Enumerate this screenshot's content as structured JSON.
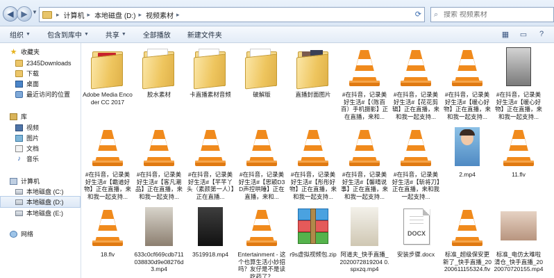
{
  "window": {
    "breadcrumb": [
      "计算机",
      "本地磁盘 (D:)",
      "视频素材"
    ],
    "search_placeholder": "搜索 视频素材"
  },
  "toolbar": {
    "organize": "组织",
    "include_in_library": "包含到库中",
    "share": "共享",
    "slideshow": "全部播放",
    "new_folder": "新建文件夹"
  },
  "nav": {
    "favorites_header": "收藏夹",
    "favorites": [
      "2345Downloads",
      "下载",
      "桌面",
      "最近访问的位置"
    ],
    "libraries_header": "库",
    "libraries": [
      "视频",
      "图片",
      "文档",
      "音乐"
    ],
    "computer_header": "计算机",
    "drives": [
      "本地磁盘 (C:)",
      "本地磁盘 (D:)",
      "本地磁盘 (E:)"
    ],
    "network_header": "网络"
  },
  "files": [
    {
      "name": "Adobe Media Encoder CC 2017",
      "icon": "folder-adobe-icon"
    },
    {
      "name": "胶水素材",
      "icon": "folder-icon"
    },
    {
      "name": "卡直播素材音频",
      "icon": "folder-icon"
    },
    {
      "name": "破解版",
      "icon": "folder-icon"
    },
    {
      "name": "直播封面图片",
      "icon": "folder-photos-icon"
    },
    {
      "name": "#在抖音，记录美好生活#【（陈百百）手机摄影】正在直播，来和...",
      "icon": "vlc-icon"
    },
    {
      "name": "#在抖音，记录美好生活#【花花剪辑】正在直播，来和我一起支持...",
      "icon": "vlc-icon"
    },
    {
      "name": "#在抖音，记录美好生活#【暖心好物】正在直播，来和我一起支持...",
      "icon": "vlc-icon"
    },
    {
      "name": "#在抖音，记录美好生活#【暖心好物】正在直播，来和我一起支持...",
      "icon": "video-thumb-phone"
    },
    {
      "name": "#在抖音，记录美好生活#【霸道好物】正在直播，来和我一起支持...",
      "icon": "vlc-icon"
    },
    {
      "name": "#在抖音，记录美好生活#【客凡潮品】正在直播，来和我一起支持...",
      "icon": "vlc-icon"
    },
    {
      "name": "#在抖音，记录美好生活#【芊芊丫头（素颜第一人）】正在直播...",
      "icon": "vlc-icon"
    },
    {
      "name": "#在抖音，记录美好生活#【思颖D3D声控哄睡】正在直播，来和...",
      "icon": "vlc-icon"
    },
    {
      "name": "#在抖音，记录美好生活#【彤彤好物】正在直播，来和我一起支持...",
      "icon": "vlc-icon"
    },
    {
      "name": "#在抖音，记录美好生活#【馨晴说事】正在直播，来和我一起支持...",
      "icon": "vlc-icon"
    },
    {
      "name": "#在抖音，记录美好生活#【斩将刀】正在直播，来和我一起支持...",
      "icon": "vlc-icon"
    },
    {
      "name": "2.mp4",
      "icon": "video-thumb-kid"
    },
    {
      "name": "11.flv",
      "icon": "vlc-icon"
    },
    {
      "name": "18.flv",
      "icon": "vlc-icon"
    },
    {
      "name": "633c0cf669cdb711038830d9e08276d3.mp4",
      "icon": "video-thumb-room"
    },
    {
      "name": "3519918.mp4",
      "icon": "video-thumb-dark"
    },
    {
      "name": "Entertainment - 这个也算生活小妙招吗？友仔是不是读吃药了？",
      "icon": "vlc-icon"
    },
    {
      "name": "r9s虚拟视频包.zip",
      "icon": "zip-archive-icon"
    },
    {
      "name": "阿道夫_快手直播_2020072819204 0.spxzq.mp4",
      "icon": "video-thumb-bottles"
    },
    {
      "name": "安装步骤.docx",
      "icon": "docx-file-icon"
    },
    {
      "name": "标准_超级保安更新了_快手直播_20200611155324.flv",
      "icon": "vlc-icon"
    },
    {
      "name": "标准_电仿太难啦清仓_快手直播_2020070720155.mp4",
      "icon": "video-thumb-women"
    }
  ],
  "colors": {
    "vlc_orange": "#f08a1c",
    "folder_yellow": "#eec55e",
    "selection_blue": "#dde8f6"
  }
}
